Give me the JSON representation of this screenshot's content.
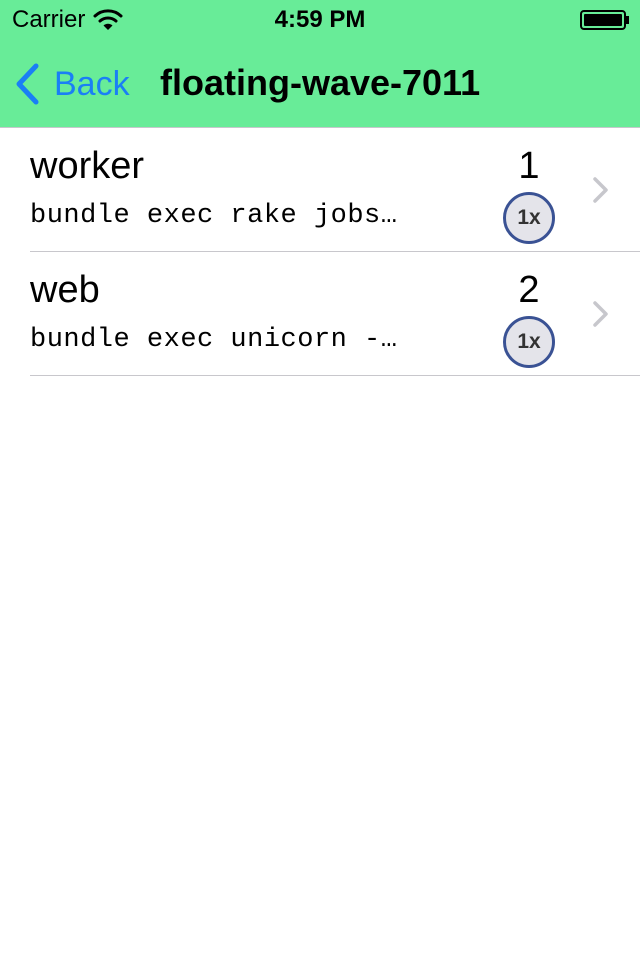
{
  "status_bar": {
    "carrier": "Carrier",
    "time": "4:59 PM",
    "wifi_icon": "wifi-icon",
    "battery_icon": "battery-icon"
  },
  "nav": {
    "back_label": "Back",
    "back_icon": "chevron-left-icon",
    "title": "floating-wave-7011"
  },
  "colors": {
    "header_bg": "#68ec98",
    "accent": "#1a7ff5",
    "badge_border": "#3a5294",
    "badge_bg": "#e4e4ea",
    "separator": "#c8c7cc"
  },
  "processes": [
    {
      "name": "worker",
      "command": "bundle exec rake jobs…",
      "count": "1",
      "size": "1x"
    },
    {
      "name": "web",
      "command": "bundle exec unicorn -…",
      "count": "2",
      "size": "1x"
    }
  ]
}
